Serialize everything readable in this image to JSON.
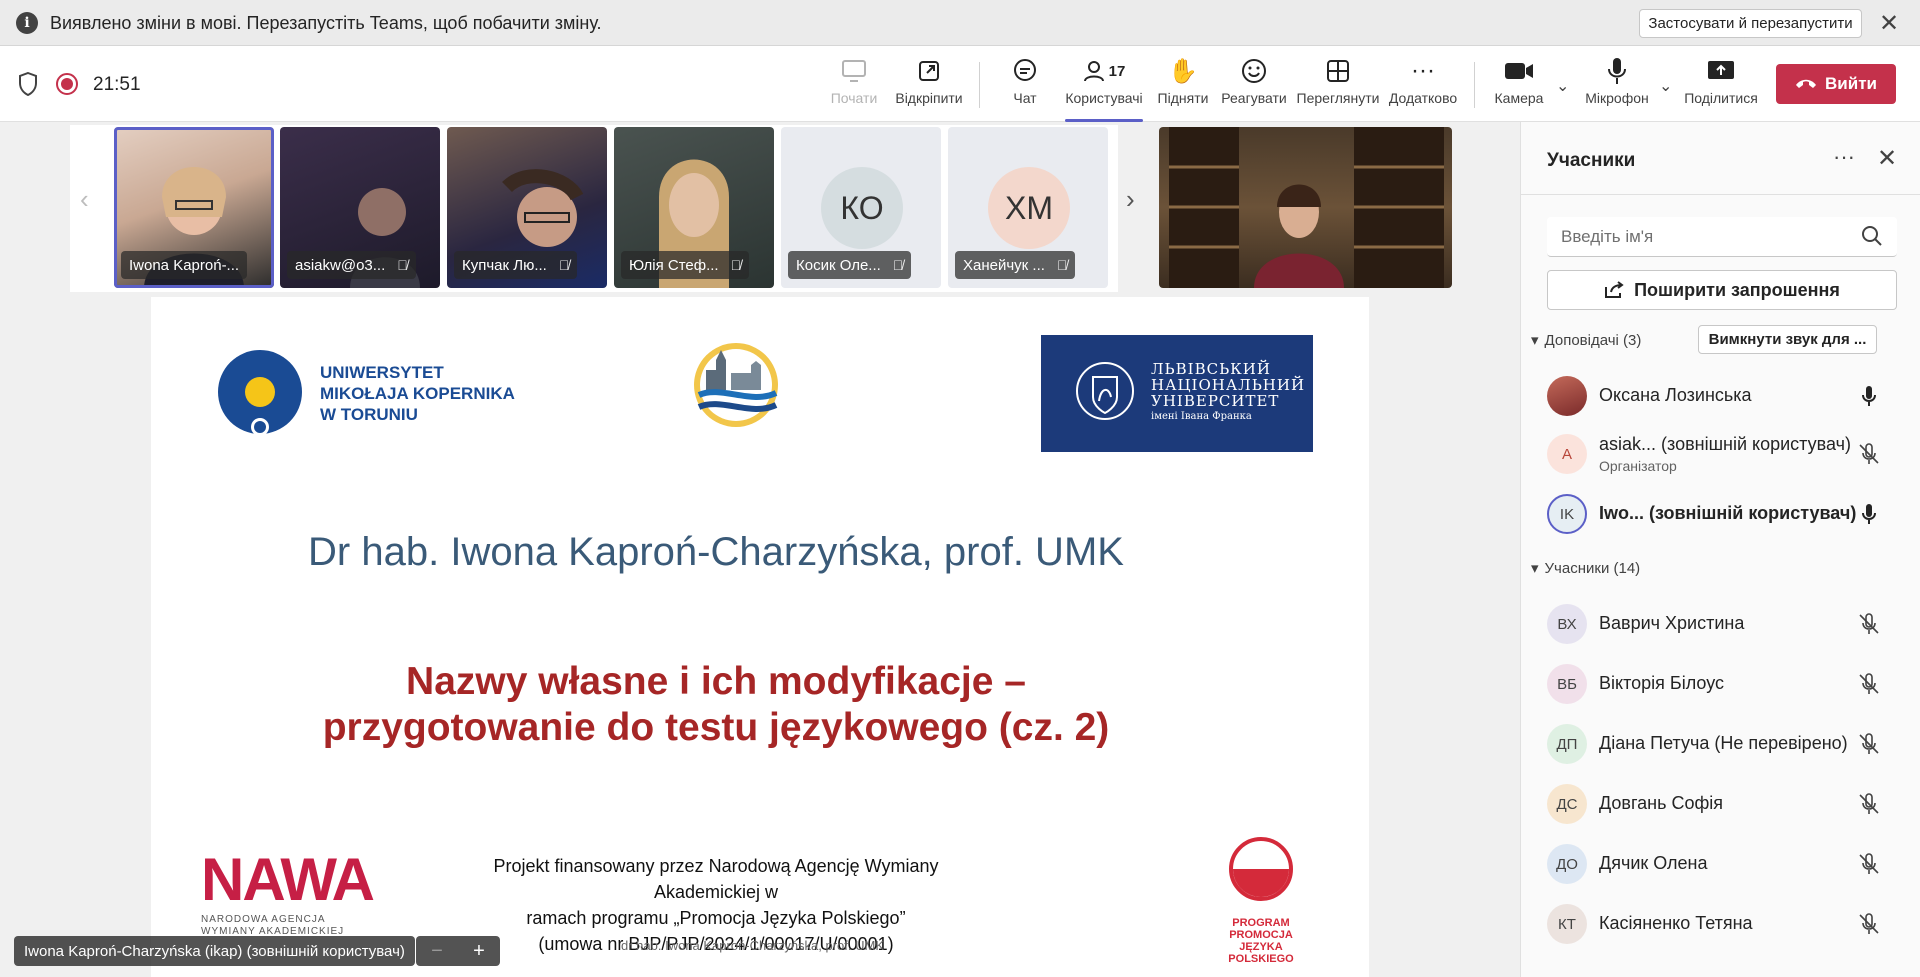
{
  "notification": {
    "text": "Виявлено зміни в мові. Перезапустіть Teams, щоб побачити зміну.",
    "apply_label": "Застосувати й перезапустити",
    "info_icon": "info-icon",
    "close_icon": "close-icon"
  },
  "toolbar": {
    "timer": "21:51",
    "start_label": "Почати",
    "popout_label": "Відкріпити",
    "chat_label": "Чат",
    "people_label": "Користувачі",
    "people_count": "17",
    "raise_label": "Підняти",
    "react_label": "Реагувати",
    "view_label": "Переглянути",
    "more_label": "Додатково",
    "camera_label": "Камера",
    "mic_label": "Мікрофон",
    "share_label": "Поділитися",
    "leave_label": "Вийти"
  },
  "video_strip": {
    "tiles": [
      {
        "name": "Iwona Kaproń-..."
      },
      {
        "name": "asiakw@o3..."
      },
      {
        "name": "Купчак Лю..."
      },
      {
        "name": "Юлія Стеф..."
      },
      {
        "name": "Косик Оле...",
        "initials": "КО"
      },
      {
        "name": "Ханейчук ...",
        "initials": "ХМ"
      }
    ]
  },
  "slide": {
    "umk_line1": "UNIWERSYTET",
    "umk_line2": "MIKOŁAJA KOPERNIKA",
    "umk_line3": "W TORUNIU",
    "lviv_line1": "ЛЬВІВСЬКИЙ",
    "lviv_line2": "НАЦІОНАЛЬНИЙ",
    "lviv_line3": "УНІВЕРСИТЕТ",
    "lviv_line4": "імені Івана Франка",
    "author": "Dr hab. Iwona Kaproń-Charzyńska, prof. UMK",
    "title_line1": "Nazwy własne i ich modyfikacje –",
    "title_line2": "przygotowanie do testu językowego (cz. 2)",
    "nawa_word": "NAWA",
    "nawa_sub1": "NARODOWA AGENCJA",
    "nawa_sub2": "WYMIANY AKADEMICKIEJ",
    "funding_line1": "Projekt finansowany przez Narodową Agencję Wymiany Akademickiej w",
    "funding_line2": "ramach programu „Promocja Języka Polskiego”",
    "funding_line3": "(umowa nr BJP/PJP/2024/1/00017/U/00001)",
    "footer": "dr hab. Iwona Kaproń-Charzyńska, prof. UMK",
    "ppjp_line1": "PROGRAM",
    "ppjp_line2": "PROMOCJA",
    "ppjp_line3": "JĘZYKA POLSKIEGO"
  },
  "speaker_tag": "Iwona Kaproń-Charzyńska (ikap) (зовнішній користувач)",
  "panel": {
    "title": "Учасники",
    "search_placeholder": "Введіть ім'я",
    "invite_label": "Поширити запрошення",
    "presenters_head": "Доповідачі (3)",
    "mute_all_label": "Вимкнути звук для ...",
    "attendees_head": "Учасники (14)",
    "presenters": [
      {
        "name": "Оксана Лозинська",
        "initials": "",
        "role": ""
      },
      {
        "name": "asiak...  (зовнішній користувач)",
        "initials": "A",
        "role": "Організатор"
      },
      {
        "name": "Iwo...   (зовнішній користувач)",
        "initials": "IK",
        "role": ""
      }
    ],
    "attendees": [
      {
        "name": "Ваврич Христина",
        "initials": "ВХ"
      },
      {
        "name": "Вікторія Білоус",
        "initials": "ВБ"
      },
      {
        "name": "Діана Петуча (Не перевірено)",
        "initials": "ДП"
      },
      {
        "name": "Довгань Софія",
        "initials": "ДС"
      },
      {
        "name": "Дячик Олена",
        "initials": "ДО"
      },
      {
        "name": "Касіяненко Тетяна",
        "initials": "КТ"
      }
    ]
  },
  "colors": {
    "accent": "#5b5fc7",
    "leave": "#c4314b",
    "slide_title": "#a62626",
    "slide_author": "#3a5a78"
  }
}
